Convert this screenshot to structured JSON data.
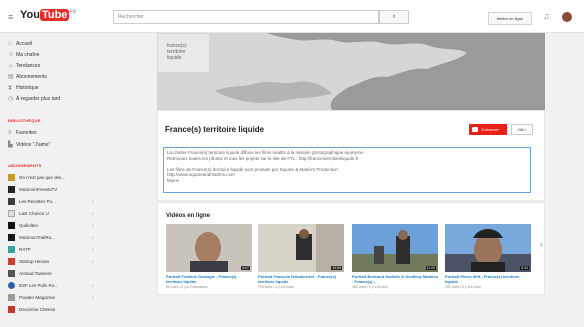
{
  "header": {
    "logo_text": "You",
    "logo_tube": "Tube",
    "logo_country": "FR",
    "search_placeholder": "Rechercher",
    "upload_label": "Mettre en ligne"
  },
  "sidebar": {
    "nav": [
      {
        "icon": "home-icon",
        "label": "Accueil"
      },
      {
        "icon": "my-channel-icon",
        "label": "Ma chaîne"
      },
      {
        "icon": "trending-icon",
        "label": "Tendances"
      },
      {
        "icon": "subscriptions-icon",
        "label": "Abonnements"
      },
      {
        "icon": "history-icon",
        "label": "Historique"
      },
      {
        "icon": "watch-later-icon",
        "label": "À regarder plus tard"
      }
    ],
    "library_heading": "BIBLIOTHÈQUE",
    "library": [
      {
        "icon": "favorites-icon",
        "label": "Favorites"
      },
      {
        "icon": "playlist-icon",
        "label": "Vidéos \"J'aime\""
      }
    ],
    "subs_heading": "ABONNEMENTS",
    "subscriptions": [
      {
        "label": "On n'est pas que des...",
        "color": "#c79a2a"
      },
      {
        "label": "SalomonFreeskiTV",
        "color": "#222222"
      },
      {
        "label": "Les Recettes Po...",
        "color": "#3a3a3a"
      },
      {
        "label": "Last Chance U",
        "color": "#dddddd"
      },
      {
        "label": "Quikolten",
        "color": "#111111"
      },
      {
        "label": "SalomonTrailRu...",
        "color": "#1a1a1a"
      },
      {
        "label": "RATP",
        "color": "#3aa0a0"
      },
      {
        "label": "Startup Heroes",
        "color": "#d04030"
      },
      {
        "label": "Arnaud Tsamere",
        "color": "#555555"
      },
      {
        "label": "ESF Les Pulls Ro...",
        "color": "#2b5fa8"
      },
      {
        "label": "Powder Magazine",
        "color": "#9a9a9a"
      },
      {
        "label": "Decorrine Cheese",
        "color": "#c0392b"
      }
    ]
  },
  "channel": {
    "logo_lines": [
      "france(s)",
      "territoire",
      "liquide"
    ],
    "title": "France(s) territoire liquide",
    "subscribe_label": "S'abonner",
    "subscriber_count": "28k+",
    "description": [
      "La chaîne France(s) territoire liquide diffuse les films relatifs à la mission photographique éponyme.",
      "Retrouvez toutes les photos et tous les projets sur le site de FTL : http://francesterritoireliquide.fr",
      "",
      "Les films de France(s) territoire liquide sont produits par Square & Martin's Production",
      "http://www.squareandmartins.com",
      "Moins"
    ]
  },
  "videos": {
    "section_title": "Vidéos en ligne",
    "items": [
      {
        "title": "Portrait Frédéric Delangle - France(s) territoire liquide",
        "meta": "66 vues • il y a 2 semaines",
        "duration": "9:07"
      },
      {
        "title": "Portrait François Deladerrière - France(s) territoire liquide",
        "meta": "795 vues • il y a 8 mois",
        "duration": "10:59"
      },
      {
        "title": "Portrait Bertrand Stofleth & Geoffroy Mathieu - France(s)...",
        "meta": "382 vues • il y a 8 mois",
        "duration": "11:00"
      },
      {
        "title": "Portrait Pierre Witt - France(s) territoire liquide",
        "meta": "281 vues • il y a 8 mois",
        "duration": "8:34"
      }
    ]
  }
}
